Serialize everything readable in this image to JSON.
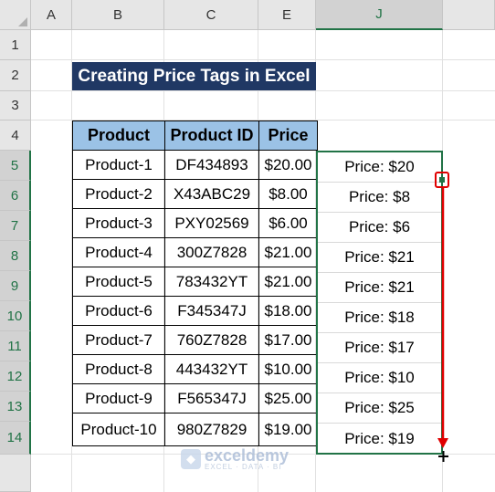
{
  "columns": [
    "A",
    "B",
    "C",
    "E",
    "J"
  ],
  "rows": [
    "1",
    "2",
    "3",
    "4",
    "5",
    "6",
    "7",
    "8",
    "9",
    "10",
    "11",
    "12",
    "13",
    "14"
  ],
  "title": "Creating Price Tags in Excel",
  "table": {
    "headers": [
      "Product",
      "Product ID",
      "Price"
    ],
    "rows": [
      [
        "Product-1",
        "DF434893",
        "$20.00"
      ],
      [
        "Product-2",
        "X43ABC29",
        "$8.00"
      ],
      [
        "Product-3",
        "PXY02569",
        "$6.00"
      ],
      [
        "Product-4",
        "300Z7828",
        "$21.00"
      ],
      [
        "Product-5",
        "783432YT",
        "$21.00"
      ],
      [
        "Product-6",
        "F345347J",
        "$18.00"
      ],
      [
        "Product-7",
        "760Z7828",
        "$17.00"
      ],
      [
        "Product-8",
        "443432YT",
        "$10.00"
      ],
      [
        "Product-9",
        "F565347J",
        "$25.00"
      ],
      [
        "Product-10",
        "980Z7829",
        "$19.00"
      ]
    ]
  },
  "price_tags": [
    "Price: $20",
    "Price: $8",
    "Price: $6",
    "Price: $21",
    "Price: $21",
    "Price: $18",
    "Price: $17",
    "Price: $10",
    "Price: $25",
    "Price: $19"
  ],
  "watermark": {
    "name": "exceldemy",
    "tagline": "EXCEL · DATA · BI"
  },
  "colors": {
    "title_bg": "#203864",
    "header_bg": "#9bc2e6",
    "selection": "#217346",
    "annotation": "#e00000"
  }
}
